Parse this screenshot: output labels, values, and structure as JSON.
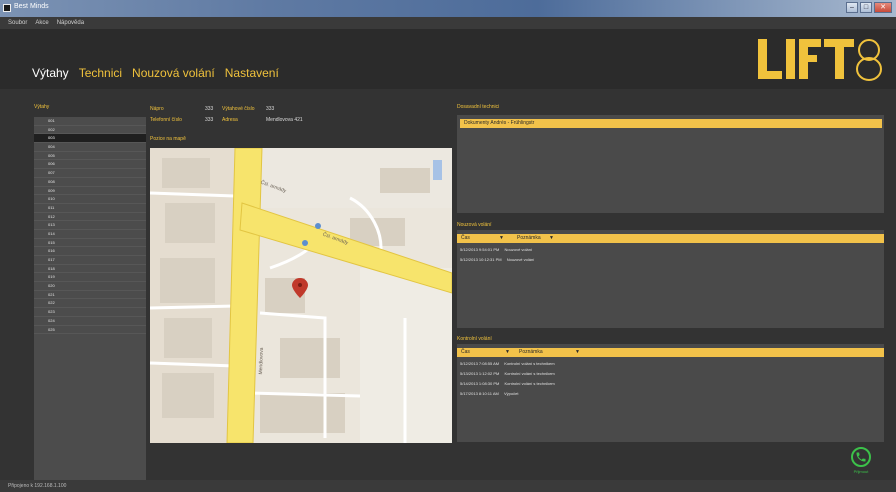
{
  "window": {
    "title": "Best Minds"
  },
  "menu": [
    "Soubor",
    "Akce",
    "Nápověda"
  ],
  "nav": {
    "tabs": [
      "Výtahy",
      "Technici",
      "Nouzová volání",
      "Nastavení"
    ]
  },
  "logo": {
    "text": "LIFT8",
    "color": "#f0c23c"
  },
  "sidebar": {
    "heading": "Výtahy",
    "items": [
      "001",
      "002",
      "003",
      "004",
      "005",
      "006",
      "007",
      "008",
      "009",
      "010",
      "011",
      "012",
      "013",
      "014",
      "015",
      "016",
      "017",
      "018",
      "019",
      "020",
      "021",
      "022",
      "023",
      "024",
      "025"
    ],
    "selected_index": 2
  },
  "details": {
    "fields": [
      {
        "label": "Nápro",
        "value": "333"
      },
      {
        "label": "Telefonní číslo",
        "value": "333"
      }
    ],
    "fields2": [
      {
        "label": "Výtahové číslo",
        "value": "333"
      },
      {
        "label": "Adresa",
        "value": "Mendlovova 421"
      }
    ],
    "map_label": "Pozice na mapě"
  },
  "assigned": {
    "heading": "Dosavadní technici",
    "selected_value": "Dokumenty Andrés - Frühlingstr"
  },
  "emergency": {
    "heading": "Nouzová volání",
    "columns": [
      "Čas",
      "Poznámka"
    ],
    "rows": [
      [
        "5/12/2013 9:54:01 PM",
        "Nouzové volání"
      ],
      [
        "5/12/2013 10:12:31 PM",
        "Nouzové volání"
      ]
    ]
  },
  "checks": {
    "heading": "Kontrolní volání",
    "columns": [
      "Čas",
      "Poznámka"
    ],
    "rows": [
      [
        "5/12/2013 7:08:55 AM",
        "Kontrolní volání s technikem"
      ],
      [
        "5/13/2013 1:12:02 PM",
        "Kontrolní volání s technikem"
      ],
      [
        "5/14/2013 1:08:30 PM",
        "Kontrolní volání s technikem"
      ],
      [
        "5/17/2013 8:10:11 AM",
        "Výpočet"
      ]
    ]
  },
  "map": {
    "street_labels": [
      "Čsl. armády",
      "Čsl. armády",
      "Mendlovova"
    ]
  },
  "call": {
    "label": "Přijmout",
    "color": "#3cc14a"
  },
  "status": {
    "text": "Připojeno k 192.168.1.100"
  }
}
